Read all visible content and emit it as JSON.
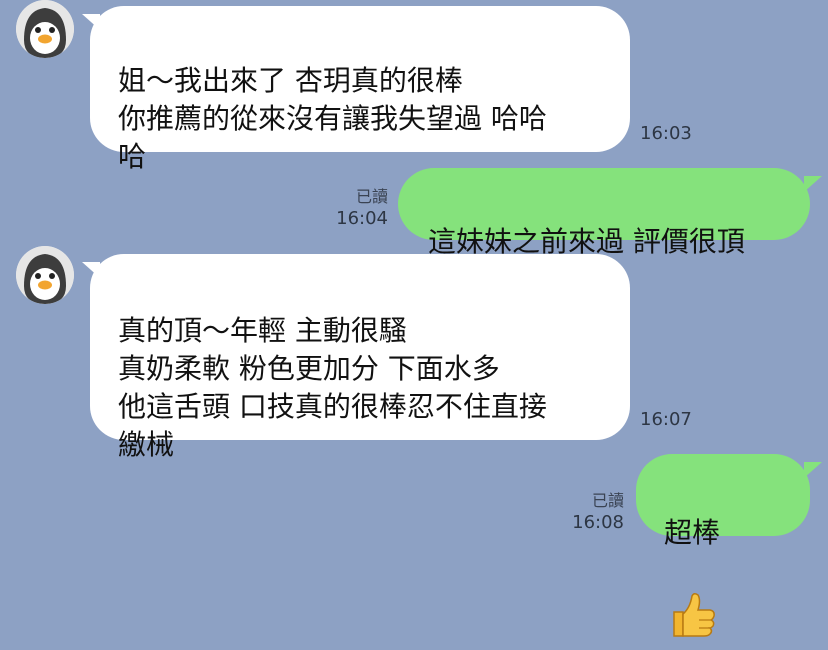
{
  "messages": [
    {
      "direction": "incoming",
      "text": "姐～我出來了 杏玥真的很棒\n你推薦的從來沒有讓我失望過 哈哈\n哈",
      "time": "16:03"
    },
    {
      "direction": "outgoing",
      "text": "這妹妹之前來過 評價很頂",
      "read": "已讀",
      "time": "16:04"
    },
    {
      "direction": "incoming",
      "text": "真的頂～年輕 主動很騷\n真奶柔軟 粉色更加分 下面水多\n他這舌頭 口技真的很棒忍不住直接\n繳械",
      "time": "16:07"
    },
    {
      "direction": "outgoing",
      "text": "超棒",
      "emoji": "thumbs-up-icon",
      "read": "已讀",
      "time": "16:08"
    }
  ],
  "colors": {
    "background": "#8da1c4",
    "incoming_bubble": "#ffffff",
    "outgoing_bubble": "#85e27c"
  },
  "avatar_icon": "penguin-avatar-icon"
}
